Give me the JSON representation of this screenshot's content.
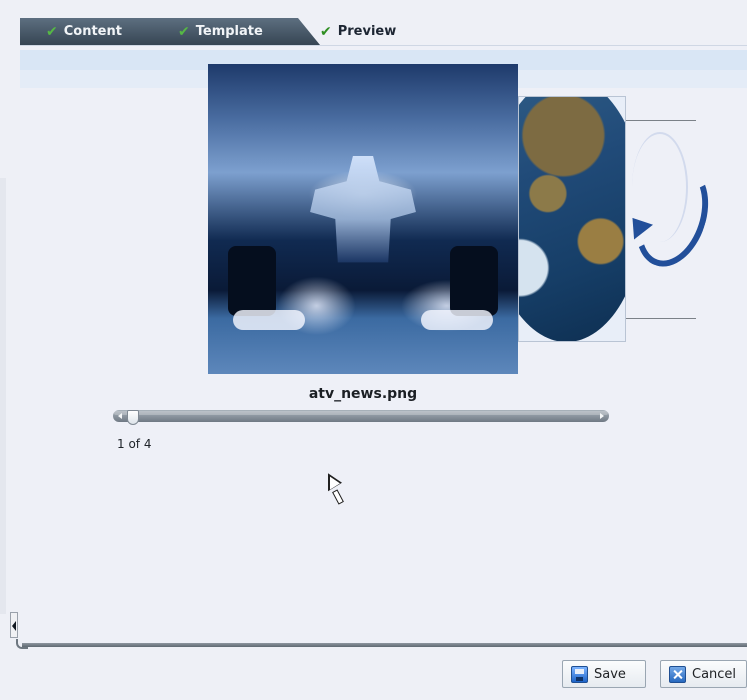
{
  "tabs": [
    {
      "label": "Content",
      "icon": "checkmark-icon"
    },
    {
      "label": "Template",
      "icon": "checkmark-icon"
    },
    {
      "label": "Preview",
      "icon": "checkmark-icon"
    }
  ],
  "preview": {
    "current_image_name": "atv_news.png",
    "position_text": "1 of 4",
    "position_fraction": 0.25
  },
  "buttons": {
    "save_label": "Save",
    "cancel_label": "Cancel"
  },
  "colors": {
    "tab_dark": "#4b5b6b",
    "panel_bg": "#eef0f7",
    "preview_band": "#dbe7f6",
    "check_green": "#3f9f2f"
  }
}
